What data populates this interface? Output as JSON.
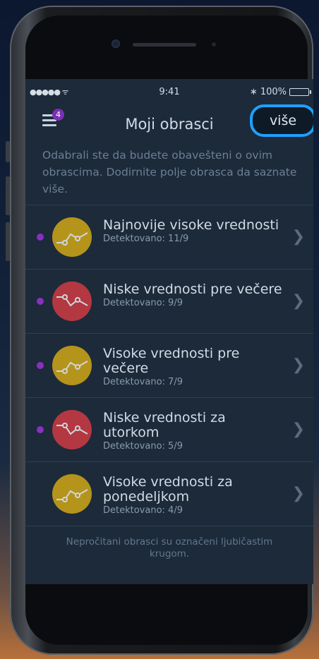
{
  "status": {
    "signal": "●●●●● ᯤ",
    "time": "9:41",
    "bluetooth": "∗",
    "battery_text": "100%",
    "battery_level": 1.0
  },
  "nav": {
    "badge_count": "4",
    "title": "Moji obrasci",
    "more_label": "više"
  },
  "intro": "Odabrali ste da budete obavešteni o ovim obrascima. Dodirnite polje obrasca da saznate više.",
  "colors": {
    "gold": "#b5941c",
    "red": "#b33842",
    "unread": "#8a2fc2",
    "highlight": "#1ea0ff"
  },
  "patterns": [
    {
      "title": "Najnovije visoke vrednosti",
      "detected": "Detektovano: 11/9",
      "kind": "high",
      "unread": true
    },
    {
      "title": "Niske vrednosti pre večere",
      "detected": "Detektovano: 9/9",
      "kind": "low",
      "unread": true
    },
    {
      "title": "Visoke vrednosti pre večere",
      "detected": "Detektovano: 7/9",
      "kind": "high",
      "unread": true
    },
    {
      "title": "Niske vrednosti za utorkom",
      "detected": "Detektovano: 5/9",
      "kind": "low",
      "unread": true
    },
    {
      "title": "Visoke vrednosti za ponedeljkom",
      "detected": "Detektovano: 4/9",
      "kind": "high",
      "unread": false
    }
  ],
  "footer_note": "Nepročitani obrasci su označeni ljubičastim krugom."
}
